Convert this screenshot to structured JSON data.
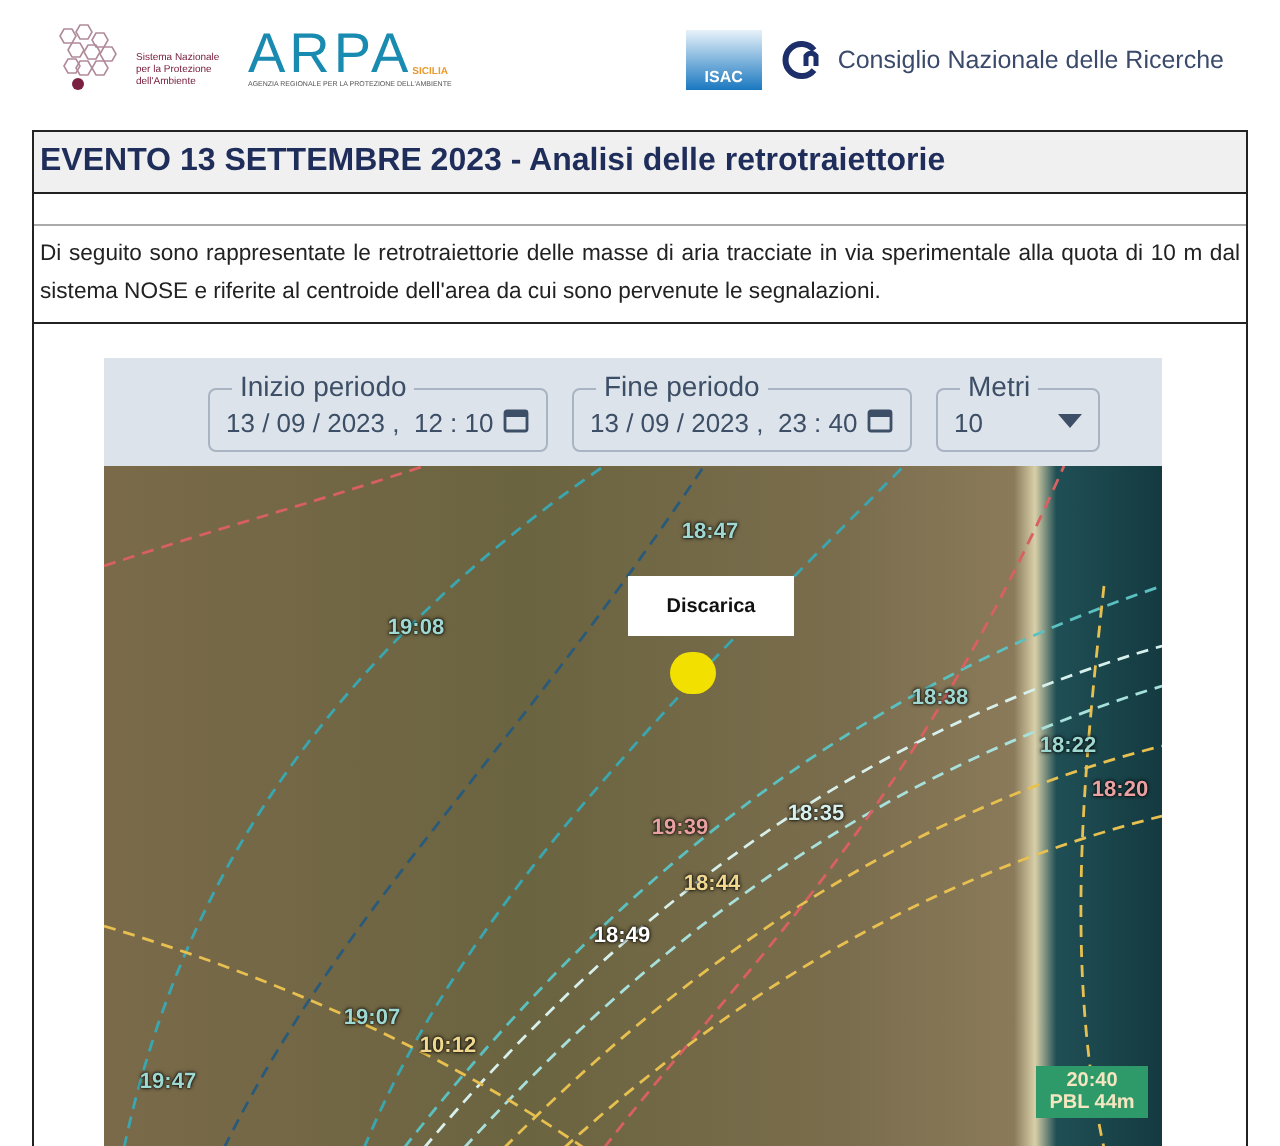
{
  "header": {
    "snpa_text": "Sistema Nazionale per la Protezione dell'Ambiente",
    "arpa": {
      "name": "ARPA",
      "region": "SICILIA",
      "subtitle": "AGENZIA REGIONALE PER LA PROTEZIONE DELL'AMBIENTE"
    },
    "isac": "ISAC",
    "cnr": "Consiglio Nazionale delle Ricerche"
  },
  "document": {
    "title": "EVENTO 13 SETTEMBRE 2023 - Analisi delle retrotraiettorie",
    "paragraph": "Di seguito sono rappresentate le retrotraiettorie delle masse di aria tracciate in via sperimentale alla quota di 10 m dal sistema NOSE e riferite al centroide dell'area da cui sono pervenute le segnalazioni."
  },
  "controls": [
    {
      "kind": "datetime",
      "label": "Inizio periodo",
      "value": "13 / 09 / 2023 ,  12 : 10"
    },
    {
      "kind": "datetime",
      "label": "Fine periodo",
      "value": "13 / 09 / 2023 ,  23 : 40"
    },
    {
      "kind": "select",
      "label": "Metri",
      "value": "10"
    }
  ],
  "map": {
    "marker_label": "Discarica",
    "time_labels": [
      {
        "text": "18:47",
        "color": "#9fd8d0"
      },
      {
        "text": "19:08",
        "color": "#9fd8d0"
      },
      {
        "text": "18:38",
        "color": "#9fd8d0"
      },
      {
        "text": "18:22",
        "color": "#9fd8d0"
      },
      {
        "text": "18:20",
        "color": "#e8a0a0"
      },
      {
        "text": "18:35",
        "color": "#d8f0ec"
      },
      {
        "text": "19:39",
        "color": "#e8a0a0"
      },
      {
        "text": "18:44",
        "color": "#f0d890"
      },
      {
        "text": "18:49",
        "color": "#ffffff"
      },
      {
        "text": "19:07",
        "color": "#9fd8d0"
      },
      {
        "text": "10:12",
        "color": "#f0d890"
      },
      {
        "text": "19:47",
        "color": "#9fd8d0"
      }
    ],
    "pbl_badge": [
      "20:40",
      "PBL 44m"
    ]
  }
}
